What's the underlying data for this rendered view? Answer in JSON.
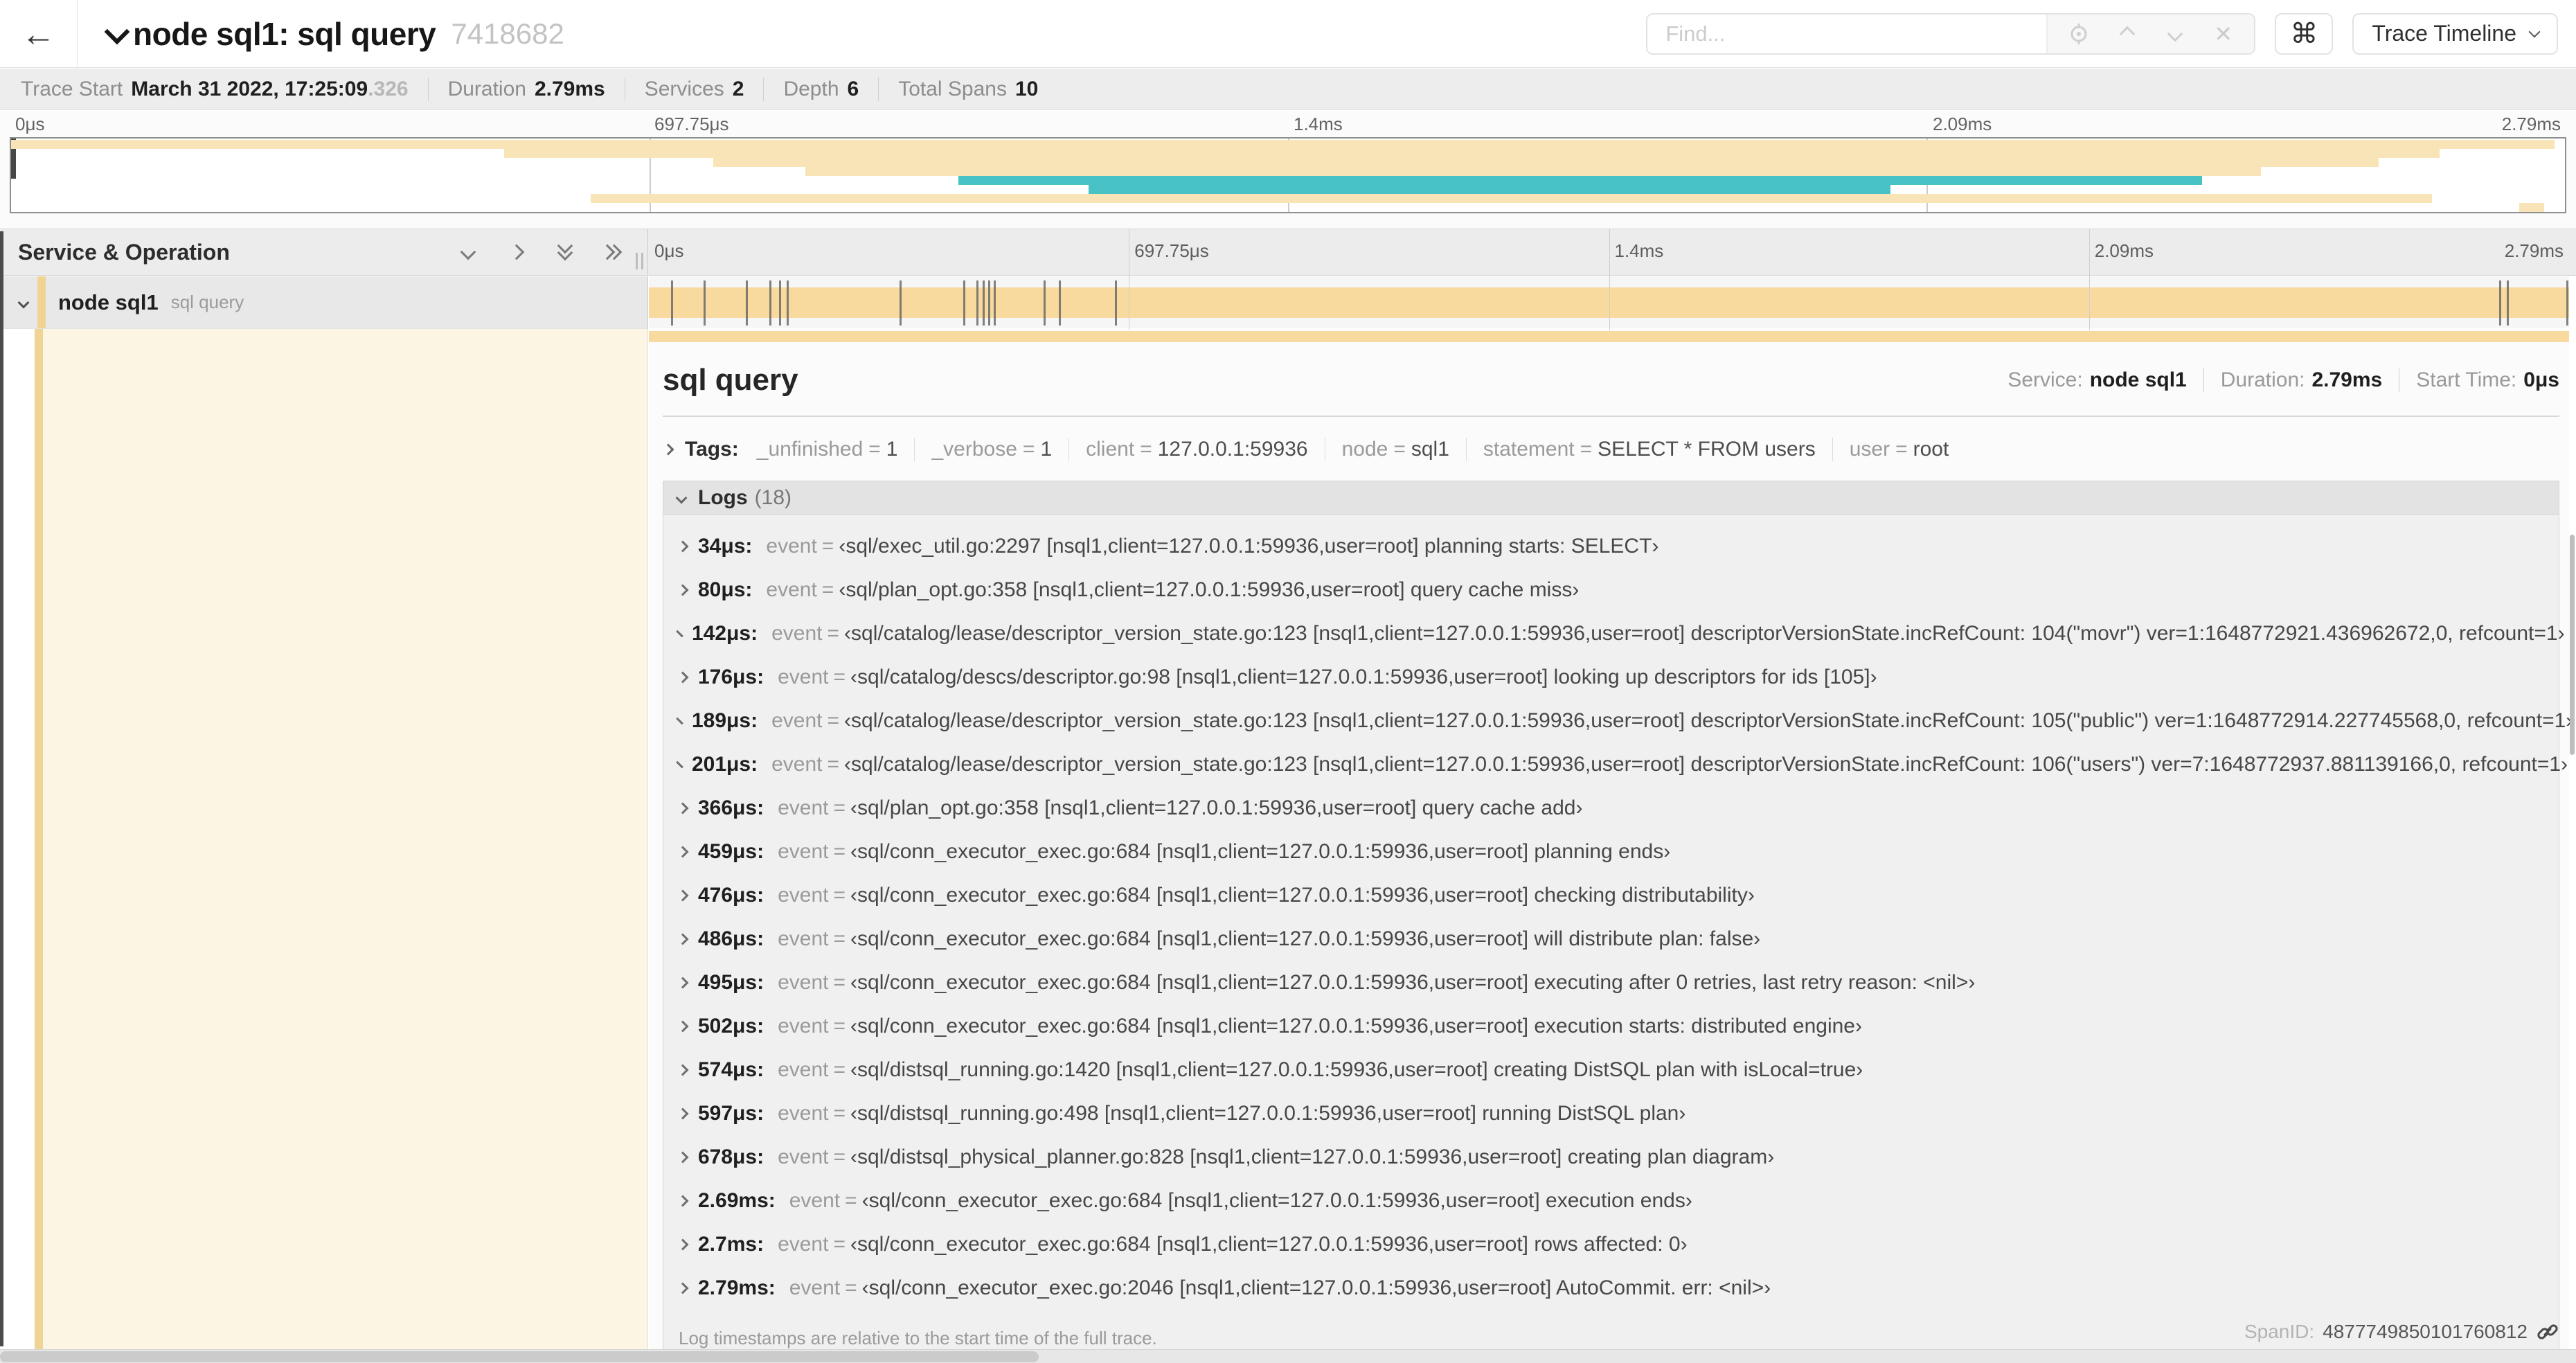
{
  "header": {
    "back_icon": "←",
    "title": "node sql1: sql query",
    "trace_id_short": "7418682",
    "find_placeholder": "Find...",
    "clear_icon": "✕",
    "cmd_icon": "⌘",
    "view_selector_label": "Trace Timeline"
  },
  "stats": [
    {
      "label": "Trace Start",
      "value": "March 31 2022, 17:25:09",
      "suffix": ".326"
    },
    {
      "label": "Duration",
      "value": "2.79ms"
    },
    {
      "label": "Services",
      "value": "2"
    },
    {
      "label": "Depth",
      "value": "6"
    },
    {
      "label": "Total Spans",
      "value": "10"
    }
  ],
  "ruler_ticks": [
    {
      "label": "0μs",
      "pct": 0
    },
    {
      "label": "697.75μs",
      "pct": 25
    },
    {
      "label": "1.4ms",
      "pct": 50
    },
    {
      "label": "2.09ms",
      "pct": 75
    },
    {
      "label": "2.79ms",
      "pct": 100
    }
  ],
  "minimap": {
    "rows": [
      {
        "color": "tan",
        "start": 0,
        "end": 99.6
      },
      {
        "color": "tan",
        "start": 19.3,
        "end": 95.1
      },
      {
        "color": "tan",
        "start": 27.5,
        "end": 92.7
      },
      {
        "color": "tan",
        "start": 31.1,
        "end": 88.1
      },
      {
        "color": "teal",
        "start": 37.1,
        "end": 85.8
      },
      {
        "color": "teal",
        "start": 42.2,
        "end": 73.6
      },
      {
        "color": "tan",
        "start": 22.7,
        "end": 94.8
      },
      {
        "color": "tan",
        "start": 98.2,
        "end": 99.2
      }
    ]
  },
  "timeline": {
    "column_header": "Service & Operation",
    "row": {
      "service": "node sql1",
      "operation": "sql query"
    },
    "log_marker_positions_pct": [
      1.2,
      2.9,
      5.1,
      6.3,
      6.8,
      7.2,
      13.1,
      16.4,
      17.1,
      17.4,
      17.7,
      18.0,
      20.6,
      21.4,
      24.3,
      96.4,
      96.8,
      99.9
    ]
  },
  "detail": {
    "title": "sql query",
    "overview": [
      {
        "label": "Service:",
        "value": "node sql1"
      },
      {
        "label": "Duration:",
        "value": "2.79ms"
      },
      {
        "label": "Start Time:",
        "value": "0μs"
      }
    ],
    "tags_label": "Tags:",
    "tags": [
      {
        "key": "_unfinished",
        "value": "1"
      },
      {
        "key": "_verbose",
        "value": "1"
      },
      {
        "key": "client",
        "value": "127.0.0.1:59936"
      },
      {
        "key": "node",
        "value": "sql1"
      },
      {
        "key": "statement",
        "value": "SELECT * FROM users"
      },
      {
        "key": "user",
        "value": "root"
      }
    ],
    "logs_label": "Logs",
    "logs_count": "(18)",
    "log_field": "event",
    "logs": [
      {
        "time": "34μs:",
        "value": "‹sql/exec_util.go:2297 [nsql1,client=127.0.0.1:59936,user=root] planning starts: SELECT›"
      },
      {
        "time": "80μs:",
        "value": "‹sql/plan_opt.go:358 [nsql1,client=127.0.0.1:59936,user=root] query cache miss›"
      },
      {
        "time": "142μs:",
        "value": "‹sql/catalog/lease/descriptor_version_state.go:123 [nsql1,client=127.0.0.1:59936,user=root] descriptorVersionState.incRefCount: 104(\"movr\") ver=1:1648772921.436962672,0, refcount=1›"
      },
      {
        "time": "176μs:",
        "value": "‹sql/catalog/descs/descriptor.go:98 [nsql1,client=127.0.0.1:59936,user=root] looking up descriptors for ids [105]›"
      },
      {
        "time": "189μs:",
        "value": "‹sql/catalog/lease/descriptor_version_state.go:123 [nsql1,client=127.0.0.1:59936,user=root] descriptorVersionState.incRefCount: 105(\"public\") ver=1:1648772914.227745568,0, refcount=1›"
      },
      {
        "time": "201μs:",
        "value": "‹sql/catalog/lease/descriptor_version_state.go:123 [nsql1,client=127.0.0.1:59936,user=root] descriptorVersionState.incRefCount: 106(\"users\") ver=7:1648772937.881139166,0, refcount=1›"
      },
      {
        "time": "366μs:",
        "value": "‹sql/plan_opt.go:358 [nsql1,client=127.0.0.1:59936,user=root] query cache add›"
      },
      {
        "time": "459μs:",
        "value": "‹sql/conn_executor_exec.go:684 [nsql1,client=127.0.0.1:59936,user=root] planning ends›"
      },
      {
        "time": "476μs:",
        "value": "‹sql/conn_executor_exec.go:684 [nsql1,client=127.0.0.1:59936,user=root] checking distributability›"
      },
      {
        "time": "486μs:",
        "value": "‹sql/conn_executor_exec.go:684 [nsql1,client=127.0.0.1:59936,user=root] will distribute plan: false›"
      },
      {
        "time": "495μs:",
        "value": "‹sql/conn_executor_exec.go:684 [nsql1,client=127.0.0.1:59936,user=root] executing after 0 retries, last retry reason: <nil>›"
      },
      {
        "time": "502μs:",
        "value": "‹sql/conn_executor_exec.go:684 [nsql1,client=127.0.0.1:59936,user=root] execution starts: distributed engine›"
      },
      {
        "time": "574μs:",
        "value": "‹sql/distsql_running.go:1420 [nsql1,client=127.0.0.1:59936,user=root] creating DistSQL plan with isLocal=true›"
      },
      {
        "time": "597μs:",
        "value": "‹sql/distsql_running.go:498 [nsql1,client=127.0.0.1:59936,user=root] running DistSQL plan›"
      },
      {
        "time": "678μs:",
        "value": "‹sql/distsql_physical_planner.go:828 [nsql1,client=127.0.0.1:59936,user=root] creating plan diagram›"
      },
      {
        "time": "2.69ms:",
        "value": "‹sql/conn_executor_exec.go:684 [nsql1,client=127.0.0.1:59936,user=root] execution ends›"
      },
      {
        "time": "2.7ms:",
        "value": "‹sql/conn_executor_exec.go:684 [nsql1,client=127.0.0.1:59936,user=root] rows affected: 0›"
      },
      {
        "time": "2.79ms:",
        "value": "‹sql/conn_executor_exec.go:2046 [nsql1,client=127.0.0.1:59936,user=root] AutoCommit. err: <nil>›"
      }
    ],
    "logs_note": "Log timestamps are relative to the start time of the full trace.",
    "spanid_label": "SpanID:",
    "spanid_value": "4877749850101760812"
  },
  "colors": {
    "span_tan": "#f8d99e",
    "minimap_tan": "#f8e4b6",
    "teal": "#49c2c6",
    "row_accent": "#f0d494",
    "detail_cream": "#fcf5e3"
  }
}
